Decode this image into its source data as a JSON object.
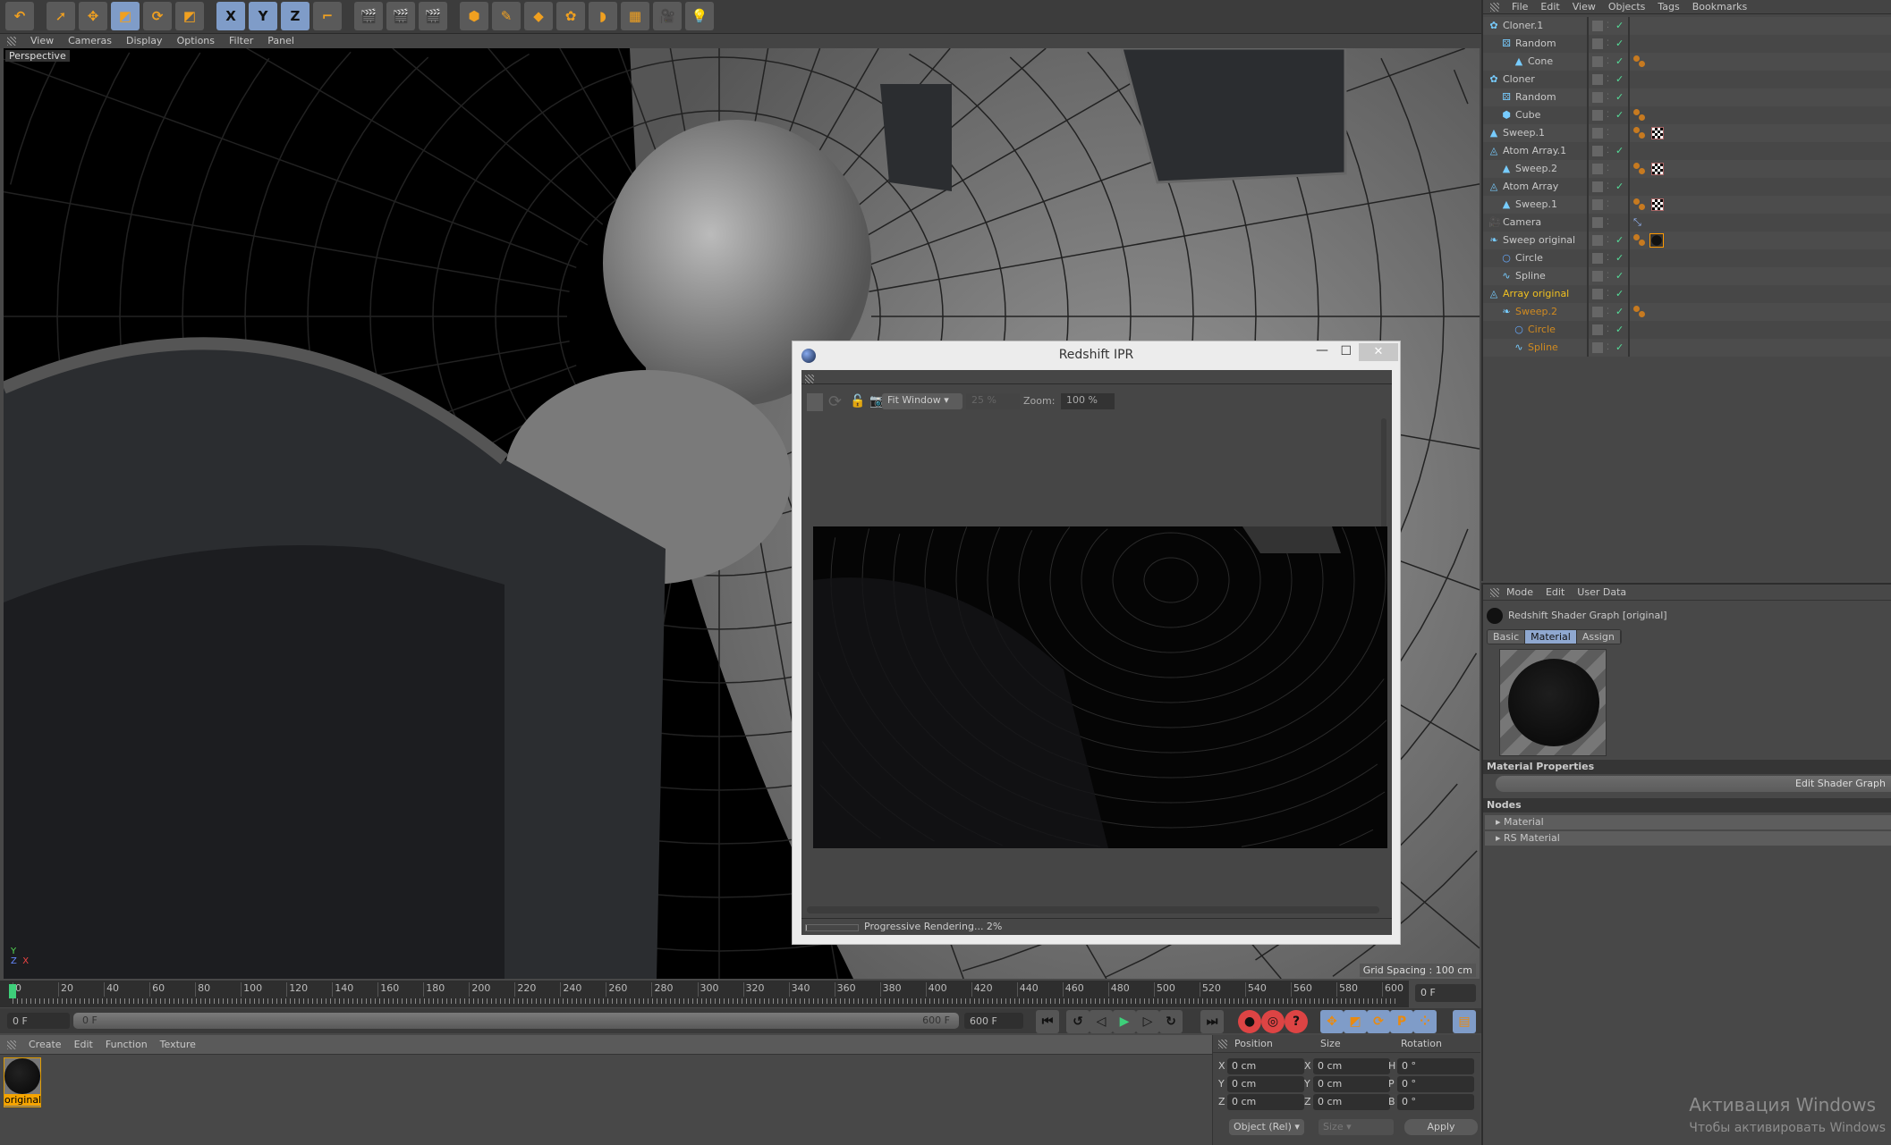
{
  "toolbar": {
    "tools": [
      {
        "icon": "undo-icon",
        "label": "↶"
      },
      {
        "icon": "select-arrow-icon",
        "label": "➚"
      },
      {
        "icon": "move-icon",
        "label": "✥"
      },
      {
        "icon": "scale-icon",
        "label": "◩",
        "active": true
      },
      {
        "icon": "rotate-icon",
        "label": "⟳"
      },
      {
        "icon": "last-tool-icon",
        "label": "◩"
      },
      {
        "icon": "x-axis-icon",
        "label": "X",
        "active": true
      },
      {
        "icon": "y-axis-icon",
        "label": "Y",
        "active": true
      },
      {
        "icon": "z-axis-icon",
        "label": "Z",
        "active": true
      },
      {
        "icon": "coordinate-system-icon",
        "label": "⌐"
      },
      {
        "icon": "render-view-icon",
        "label": "🎬"
      },
      {
        "icon": "render-picture-viewer-icon",
        "label": "🎬"
      },
      {
        "icon": "render-settings-icon",
        "label": "🎬"
      },
      {
        "icon": "cube-primitive-icon",
        "label": "⬢"
      },
      {
        "icon": "pen-spline-icon",
        "label": "✎"
      },
      {
        "icon": "subdivision-icon",
        "label": "◆"
      },
      {
        "icon": "cloner-icon",
        "label": "✿"
      },
      {
        "icon": "deformer-icon",
        "label": "◗"
      },
      {
        "icon": "floor-icon",
        "label": "▦"
      },
      {
        "icon": "camera-icon",
        "label": "🎥"
      },
      {
        "icon": "light-icon",
        "label": "💡"
      }
    ]
  },
  "viewport": {
    "menu": [
      "View",
      "Cameras",
      "Display",
      "Options",
      "Filter",
      "Panel"
    ],
    "label": "Perspective",
    "grid_spacing": "Grid Spacing : 100 cm"
  },
  "timeline": {
    "min": 0,
    "max": 600,
    "step": 20,
    "current": 0,
    "current_frame": "0 F",
    "start": "0 F",
    "range_start": "0 F",
    "range_end": "600 F",
    "end": "600 F"
  },
  "transport": [
    {
      "icon": "go-to-start-icon",
      "label": "⏮"
    },
    {
      "icon": "previous-key-icon",
      "label": "↺"
    },
    {
      "icon": "previous-frame-icon",
      "label": "◁"
    },
    {
      "icon": "play-icon",
      "label": "▶"
    },
    {
      "icon": "next-frame-icon",
      "label": "▷"
    },
    {
      "icon": "next-key-icon",
      "label": "↻"
    },
    {
      "icon": "go-to-end-icon",
      "label": "⏭"
    },
    {
      "icon": "record-keys-icon",
      "label": "●"
    },
    {
      "icon": "autokey-icon",
      "label": "◎"
    },
    {
      "icon": "keyframe-selection-icon",
      "label": "?"
    },
    {
      "icon": "record-position-icon",
      "label": "✥"
    },
    {
      "icon": "record-scale-icon",
      "label": "◩"
    },
    {
      "icon": "record-rotation-icon",
      "label": "⟳"
    },
    {
      "icon": "record-parameter-icon",
      "label": "P"
    },
    {
      "icon": "record-pla-icon",
      "label": "⁘"
    },
    {
      "icon": "timeline-window-icon",
      "label": "▤"
    }
  ],
  "material_manager": {
    "menu": [
      "Create",
      "Edit",
      "Function",
      "Texture"
    ],
    "materials": [
      {
        "name": "original"
      }
    ]
  },
  "coordinates": {
    "headers": [
      "Position",
      "Size",
      "Rotation"
    ],
    "rows": [
      {
        "pl": "X",
        "p": "0 cm",
        "sl": "X",
        "s": "0 cm",
        "rl": "H",
        "r": "0 °"
      },
      {
        "pl": "Y",
        "p": "0 cm",
        "sl": "Y",
        "s": "0 cm",
        "rl": "P",
        "r": "0 °"
      },
      {
        "pl": "Z",
        "p": "0 cm",
        "sl": "Z",
        "s": "0 cm",
        "rl": "B",
        "r": "0 °"
      }
    ],
    "mode": "Object (Rel)",
    "size_mode": "Size",
    "apply": "Apply"
  },
  "object_manager": {
    "menu": [
      "File",
      "Edit",
      "View",
      "Objects",
      "Tags",
      "Bookmarks"
    ],
    "objects": [
      {
        "name": "Cloner.1",
        "depth": 0,
        "icon": "cloner-icon",
        "glyph": "✿",
        "color": "#c8c8c8",
        "check": true,
        "tags": []
      },
      {
        "name": "Random",
        "depth": 1,
        "icon": "random-effector-icon",
        "glyph": "⚄",
        "color": "#c8c8c8",
        "check": true,
        "tags": []
      },
      {
        "name": "Cone",
        "depth": 2,
        "icon": "cone-icon",
        "glyph": "▲",
        "color": "#c8c8c8",
        "check": true,
        "tags": [
          "phong"
        ]
      },
      {
        "name": "Cloner",
        "depth": 0,
        "icon": "cloner-icon",
        "glyph": "✿",
        "color": "#c8c8c8",
        "check": true,
        "tags": []
      },
      {
        "name": "Random",
        "depth": 1,
        "icon": "random-effector-icon",
        "glyph": "⚄",
        "color": "#c8c8c8",
        "check": true,
        "tags": []
      },
      {
        "name": "Cube",
        "depth": 1,
        "icon": "cube-icon",
        "glyph": "⬢",
        "color": "#c8c8c8",
        "check": true,
        "tags": [
          "phong"
        ]
      },
      {
        "name": "Sweep.1",
        "depth": 0,
        "icon": "sweep-icon",
        "glyph": "▲",
        "color": "#c8c8c8",
        "check": false,
        "tags": [
          "phong",
          "checker"
        ]
      },
      {
        "name": "Atom Array.1",
        "depth": 0,
        "icon": "atom-array-icon",
        "glyph": "◬",
        "color": "#c8c8c8",
        "check": true,
        "tags": []
      },
      {
        "name": "Sweep.2",
        "depth": 1,
        "icon": "sweep-icon",
        "glyph": "▲",
        "color": "#c8c8c8",
        "check": false,
        "tags": [
          "phong",
          "checker"
        ]
      },
      {
        "name": "Atom Array",
        "depth": 0,
        "icon": "atom-array-icon",
        "glyph": "◬",
        "color": "#c8c8c8",
        "check": true,
        "tags": []
      },
      {
        "name": "Sweep.1",
        "depth": 1,
        "icon": "sweep-icon",
        "glyph": "▲",
        "color": "#c8c8c8",
        "check": false,
        "tags": [
          "phong",
          "checker"
        ]
      },
      {
        "name": "Camera",
        "depth": 0,
        "icon": "camera-icon",
        "glyph": "🎥",
        "color": "#c8c8c8",
        "check": false,
        "tags": [
          "target"
        ]
      },
      {
        "name": "Sweep original",
        "depth": 0,
        "icon": "sweep-nurbs-icon",
        "glyph": "❧",
        "color": "#c8c8c8",
        "check": true,
        "tags": [
          "phong",
          "material"
        ]
      },
      {
        "name": "Circle",
        "depth": 1,
        "icon": "circle-spline-icon",
        "glyph": "○",
        "color": "#c8c8c8",
        "check": true,
        "tags": []
      },
      {
        "name": "Spline",
        "depth": 1,
        "icon": "spline-icon",
        "glyph": "∿",
        "color": "#c8c8c8",
        "check": true,
        "tags": []
      },
      {
        "name": "Array original",
        "depth": 0,
        "icon": "atom-array-icon",
        "glyph": "◬",
        "color": "#f0c020",
        "check": true,
        "tags": []
      },
      {
        "name": "Sweep.2",
        "depth": 1,
        "icon": "sweep-nurbs-icon",
        "glyph": "❧",
        "color": "#d08a20",
        "check": true,
        "tags": [
          "phong"
        ]
      },
      {
        "name": "Circle",
        "depth": 2,
        "icon": "circle-spline-icon",
        "glyph": "○",
        "color": "#d08a20",
        "check": true,
        "tags": []
      },
      {
        "name": "Spline",
        "depth": 2,
        "icon": "spline-icon",
        "glyph": "∿",
        "color": "#d08a20",
        "check": true,
        "tags": []
      }
    ]
  },
  "attribute_manager": {
    "menu": [
      "Mode",
      "Edit",
      "User Data"
    ],
    "title": "Redshift Shader Graph [original]",
    "tabs": [
      "Basic",
      "Material",
      "Assign"
    ],
    "active_tab": "Material",
    "section1": "Material Properties",
    "button": "Edit Shader Graph",
    "section2": "Nodes",
    "nodes": [
      "Material",
      "RS Material"
    ]
  },
  "ipr": {
    "title": "Redshift IPR",
    "fit": "Fit Window",
    "percent": "25 %",
    "zoom_label": "Zoom:",
    "zoom": "100 %",
    "status": "Progressive Rendering... 2%",
    "progress": 0.02
  },
  "watermark": {
    "line1": "Активация Windows",
    "line2": "Чтобы активировать Windows"
  }
}
